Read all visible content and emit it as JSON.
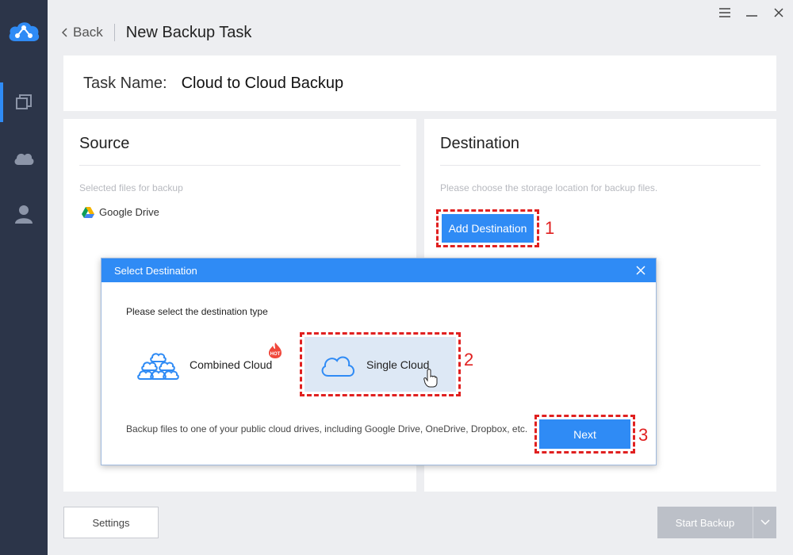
{
  "sidebar": {
    "logo_icon": "cloud-network-logo-icon",
    "items": [
      {
        "icon": "copy-backup-icon",
        "active": true
      },
      {
        "icon": "cloud-icon",
        "active": false
      },
      {
        "icon": "user-icon",
        "active": false
      }
    ]
  },
  "window": {
    "controls": [
      "menu-icon",
      "minimize-icon",
      "close-icon"
    ]
  },
  "header": {
    "back_label": "Back",
    "title": "New Backup Task"
  },
  "task": {
    "label": "Task Name:",
    "value": "Cloud to Cloud Backup"
  },
  "source": {
    "title": "Source",
    "hint": "Selected files for backup",
    "items": [
      {
        "icon": "google-drive-icon",
        "label": "Google Drive"
      }
    ]
  },
  "destination": {
    "title": "Destination",
    "hint": "Please choose the storage location for backup files.",
    "add_button": "Add Destination"
  },
  "markers": [
    "1",
    "2",
    "3"
  ],
  "dialog": {
    "title": "Select Destination",
    "prompt": "Please select the destination type",
    "options": [
      {
        "label": "Combined Cloud",
        "icon": "combined-cloud-icon",
        "badge": "HOT",
        "selected": false
      },
      {
        "label": "Single Cloud",
        "icon": "single-cloud-icon",
        "selected": true
      }
    ],
    "description": "Backup files to one of your public cloud drives, including Google Drive, OneDrive, Dropbox, etc.",
    "next_button": "Next"
  },
  "footer": {
    "settings_button": "Settings",
    "start_button": "Start Backup"
  },
  "colors": {
    "accent": "#2f8bf5",
    "sidebar_bg": "#2c3549",
    "highlight_red": "#e02020",
    "selected_bg": "#dde8f5",
    "disabled_button": "#bcc0c8"
  }
}
